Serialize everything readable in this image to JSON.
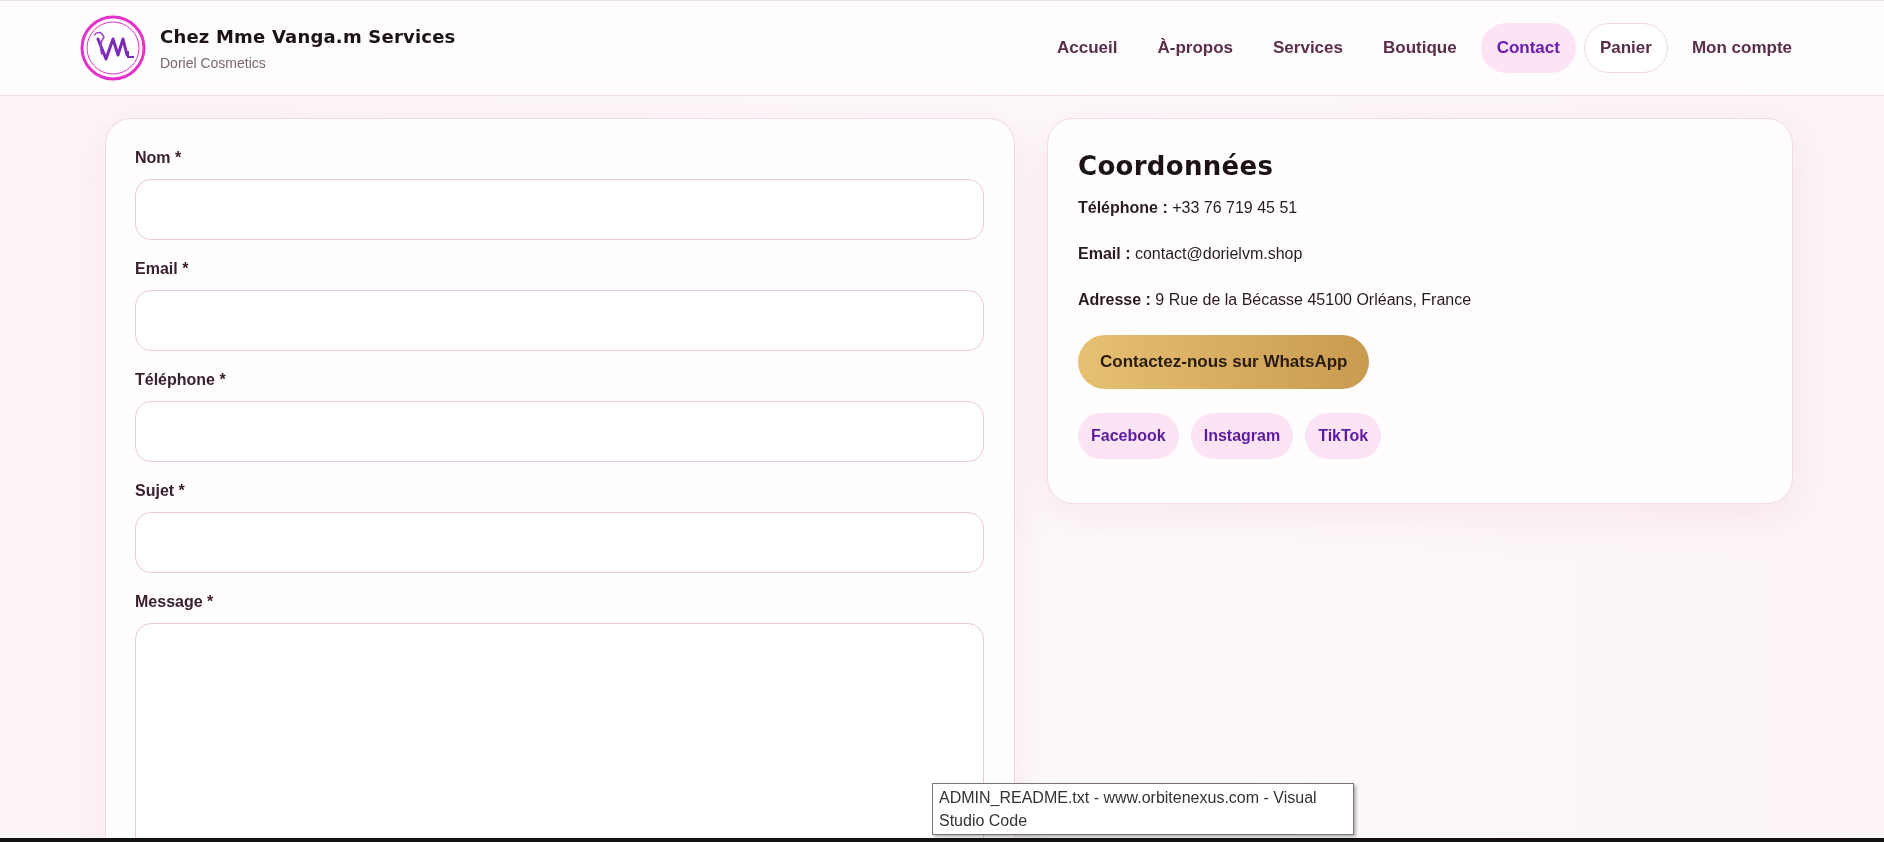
{
  "header": {
    "title": "Chez Mme Vanga.m Services",
    "subtitle": "Doriel Cosmetics"
  },
  "nav": [
    {
      "label": "Accueil",
      "selected": false,
      "kind": "link"
    },
    {
      "label": "À-propos",
      "selected": false,
      "kind": "link"
    },
    {
      "label": "Services",
      "selected": false,
      "kind": "link"
    },
    {
      "label": "Boutique",
      "selected": false,
      "kind": "link"
    },
    {
      "label": "Contact",
      "selected": true,
      "kind": "link"
    },
    {
      "label": "Panier",
      "selected": false,
      "kind": "outlined"
    },
    {
      "label": "Mon compte",
      "selected": false,
      "kind": "link"
    }
  ],
  "form": {
    "fields": [
      {
        "label": "Nom *",
        "kind": "input"
      },
      {
        "label": "Email *",
        "kind": "input"
      },
      {
        "label": "Téléphone *",
        "kind": "input"
      },
      {
        "label": "Sujet *",
        "kind": "input"
      },
      {
        "label": "Message *",
        "kind": "textarea"
      }
    ]
  },
  "contact": {
    "title": "Coordonnées",
    "lines": [
      "**Téléphone :** +33 76 719 45 51",
      "**Email :** contact@dorielvm.shop",
      "**Adresse :** 9 Rue de la Bécasse 45100 Orléans, France"
    ],
    "whatsapp_button": "Contactez-nous sur WhatsApp",
    "social_links": [
      "Facebook",
      "Instagram",
      "TikTok"
    ]
  },
  "tooltip": {
    "text": "ADMIN_README.txt - www.orbitenexus.com - Visual Studio Code"
  }
}
